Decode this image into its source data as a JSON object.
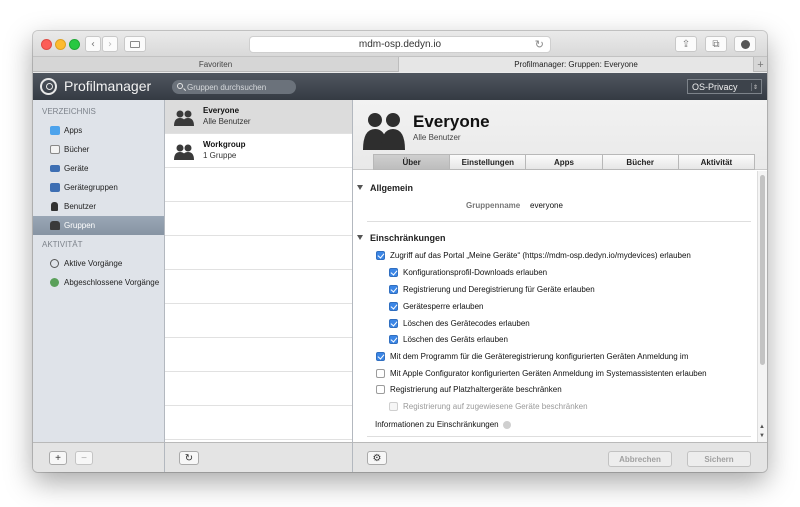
{
  "browser": {
    "url": "mdm-osp.dedyn.io",
    "tabs": [
      {
        "label": "Favoriten"
      },
      {
        "label": "Profilmanager: Gruppen: Everyone"
      }
    ],
    "colors": {
      "close": "#fc5d57",
      "minimize": "#fdbb2e",
      "zoom": "#27c841"
    }
  },
  "app": {
    "title": "Profilmanager",
    "search_placeholder": "Gruppen durchsuchen",
    "org": "OS-Privacy"
  },
  "sidebar": {
    "section1": "VERZEICHNIS",
    "items": [
      {
        "label": "Apps",
        "icon": "apps-icon"
      },
      {
        "label": "Bücher",
        "icon": "books-icon"
      },
      {
        "label": "Geräte",
        "icon": "device-icon"
      },
      {
        "label": "Gerätegruppen",
        "icon": "device-group-icon"
      },
      {
        "label": "Benutzer",
        "icon": "user-icon"
      },
      {
        "label": "Gruppen",
        "icon": "group-icon",
        "selected": true
      }
    ],
    "section2": "AKTIVITÄT",
    "activity": [
      {
        "label": "Aktive Vorgänge",
        "icon": "clock-icon"
      },
      {
        "label": "Abgeschlossene Vorgänge",
        "icon": "check-icon"
      }
    ],
    "add": "+",
    "remove": "−"
  },
  "groups": [
    {
      "name": "Everyone",
      "sub": "Alle Benutzer",
      "selected": true
    },
    {
      "name": "Workgroup",
      "sub": "1 Gruppe"
    }
  ],
  "detail": {
    "title": "Everyone",
    "subtitle": "Alle Benutzer",
    "tabs": [
      "Über",
      "Einstellungen",
      "Apps",
      "Bücher",
      "Aktivität"
    ],
    "general": {
      "heading": "Allgemein",
      "group_name_label": "Gruppenname",
      "group_name_value": "everyone"
    },
    "restrictions": {
      "heading": "Einschränkungen",
      "options": [
        {
          "label": "Zugriff auf das Portal „Meine Geräte“ (https://mdm-osp.dedyn.io/mydevices) erlauben",
          "checked": true,
          "level": 0
        },
        {
          "label": "Konfigurationsprofil-Downloads erlauben",
          "checked": true,
          "level": 1
        },
        {
          "label": "Registrierung und Deregistrierung für Geräte erlauben",
          "checked": true,
          "level": 1
        },
        {
          "label": "Gerätesperre erlauben",
          "checked": true,
          "level": 1
        },
        {
          "label": "Löschen des Gerätecodes erlauben",
          "checked": true,
          "level": 1
        },
        {
          "label": "Löschen des Geräts erlauben",
          "checked": true,
          "level": 1
        },
        {
          "label": "Mit dem Programm für die Geräteregistrierung konfigurierten Geräten Anmeldung im",
          "checked": true,
          "level": 0
        },
        {
          "label": "Mit Apple Configurator konfigurierten Geräten Anmeldung im Systemassistenten erlauben",
          "checked": false,
          "level": 0
        },
        {
          "label": "Registrierung auf Platzhaltergeräte beschränken",
          "checked": false,
          "level": 0
        },
        {
          "label": "Registrierung auf zugewiesene Geräte beschränken",
          "checked": false,
          "level": 1,
          "disabled": true
        }
      ],
      "info": "Informationen zu Einschränkungen"
    },
    "cancel": "Abbrechen",
    "save": "Sichern"
  }
}
